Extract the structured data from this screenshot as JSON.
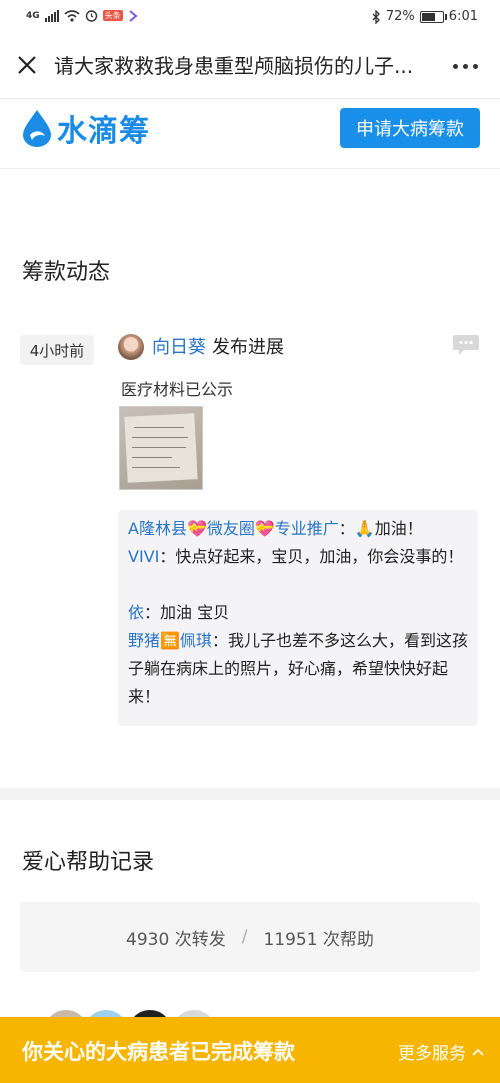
{
  "status_bar": {
    "network": "4G",
    "battery": "72%",
    "battery_level": 0.72,
    "time": "6:01"
  },
  "title_bar": {
    "title": "请大家救救我身患重型颅脑损伤的儿子..."
  },
  "brand": {
    "name": "水滴筹",
    "apply_button": "申请大病筹款",
    "accent": "#1a8fe8"
  },
  "updates": {
    "heading": "筹款动态",
    "time_ago": "4小时前",
    "poster_name": "向日葵",
    "action": "发布进展",
    "text": "医疗材料已公示",
    "comments": [
      {
        "nick": "A隆林县💝微友圈💝专业推广",
        "text": "：🙏加油！"
      },
      {
        "nick": "VIVI",
        "text": "：快点好起来，宝贝，加油，你会没事的！"
      },
      {
        "nick": "依",
        "text": "：加油 宝贝"
      },
      {
        "nick": "野猪🈚佩琪",
        "text": "：我儿子也差不多这么大，看到这孩子躺在病床上的照片，好心痛，希望快快好起来！"
      }
    ]
  },
  "help_records": {
    "heading": "爱心帮助记录",
    "shares": "4930 次转发",
    "separator": "/",
    "helps": "11951 次帮助"
  },
  "footer": {
    "message": "你关心的大病患者已完成筹款",
    "more_services": "更多服务",
    "color": "#f7b500"
  }
}
